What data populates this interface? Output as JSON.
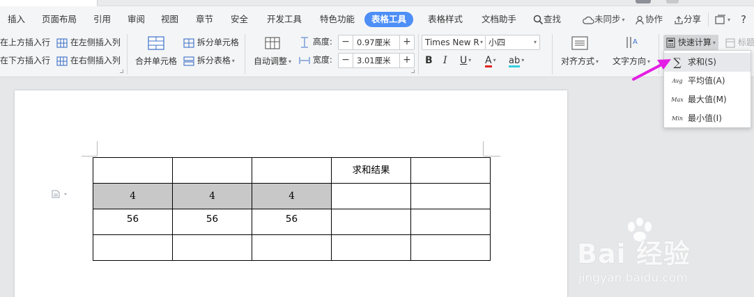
{
  "menu": {
    "tabs": [
      "插入",
      "页面布局",
      "引用",
      "审阅",
      "视图",
      "章节",
      "安全",
      "开发工具",
      "特色功能",
      "表格工具",
      "表格样式",
      "文档助手"
    ],
    "active_tab": "表格工具",
    "search": "查找",
    "sync": "未同步",
    "collab": "协作",
    "share": "分享",
    "help": "?"
  },
  "ribbon": {
    "insert_above": "在上方插入行",
    "insert_below": "在下方插入行",
    "insert_left": "在左侧插入列",
    "insert_right": "在右侧插入列",
    "merge_cells": "合并单元格",
    "split_cells": "拆分单元格",
    "split_table": "拆分表格",
    "auto_fit": "自动调整",
    "height_label": "高度:",
    "height_value": "0.97厘米",
    "width_label": "宽度:",
    "width_value": "3.01厘米",
    "font_name": "Times New R",
    "font_size": "小四",
    "align": "对齐方式",
    "text_direction": "文字方向",
    "quick_calc": "快速计算",
    "title_row": "标题"
  },
  "dropdown": [
    {
      "icon": "sum-icon",
      "glyph": "∑",
      "label": "求和(S)"
    },
    {
      "icon": "avg-icon",
      "glyph": "Avg",
      "label": "平均值(A)"
    },
    {
      "icon": "max-icon",
      "glyph": "Max",
      "label": "最大值(M)"
    },
    {
      "icon": "min-icon",
      "glyph": "Min",
      "label": "最小值(I)"
    }
  ],
  "table": {
    "rows": [
      [
        "",
        "",
        "",
        "求和结果",
        ""
      ],
      [
        "4",
        "4",
        "4",
        "",
        ""
      ],
      [
        "56",
        "56",
        "56",
        "",
        ""
      ],
      [
        "",
        "",
        "",
        "",
        ""
      ]
    ]
  },
  "watermark": {
    "brand": "Bai  经验",
    "url": "jingyan.baidu.com"
  },
  "colors": {
    "accent": "#4d8ef7",
    "arrow": "#e41ee4",
    "selection": "#c8c8c8"
  }
}
